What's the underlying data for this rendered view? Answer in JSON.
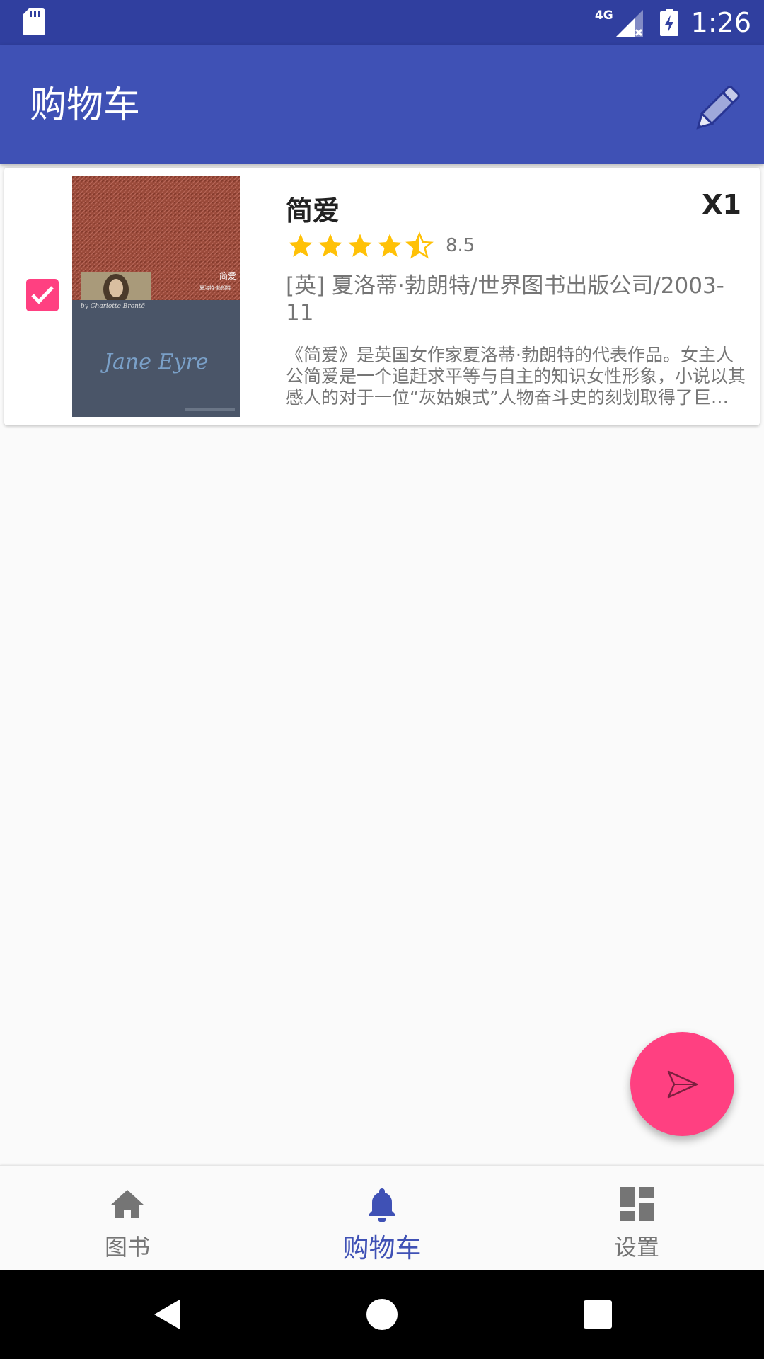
{
  "status_bar": {
    "network": "4G",
    "time": "1:26"
  },
  "app_bar": {
    "title": "购物车"
  },
  "cart_items": [
    {
      "selected": true,
      "title": "简爱",
      "quantity": "X1",
      "rating": "8.5",
      "rating_stars": 4.5,
      "author_info": "[英] 夏洛蒂·勃朗特/世界图书出版公司/2003-11",
      "description": "《简爱》是英国女作家夏洛蒂·勃朗特的代表作品。女主人公简爱是一个追赶求平等与自主的知识女性形象，小说以其感人的对于一位“灰姑娘式”人物奋斗史的刻划取得了巨大的成功。",
      "cover_icon": "book-cover-image"
    }
  ],
  "bottom_nav": {
    "items": [
      {
        "label": "图书",
        "icon": "home-icon",
        "active": false
      },
      {
        "label": "购物车",
        "icon": "bell-icon",
        "active": true
      },
      {
        "label": "设置",
        "icon": "dashboard-icon",
        "active": false
      }
    ]
  },
  "colors": {
    "status_bar": "#303f9f",
    "primary": "#3f51b5",
    "accent": "#ff4081",
    "star": "#ffc107"
  }
}
